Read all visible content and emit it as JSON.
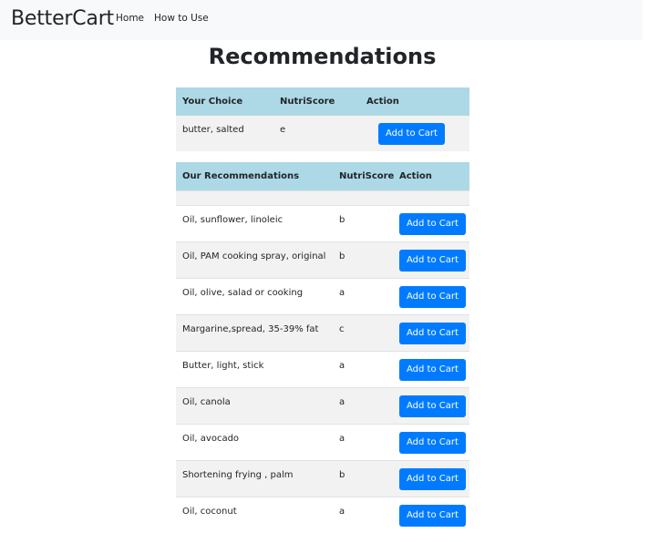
{
  "navbar": {
    "brand": "BetterCart",
    "links": [
      "Home",
      "How to Use"
    ]
  },
  "page_title": "Recommendations",
  "choice_table": {
    "headers": [
      "Your Choice",
      "NutriScore",
      "Action"
    ],
    "row": {
      "name": "butter, salted",
      "score": "e",
      "action": "Add to Cart"
    }
  },
  "recommendations_table": {
    "headers": [
      "Our Recommendations",
      "NutriScore",
      "Action"
    ],
    "rows": [
      {
        "name": "Oil, sunflower, linoleic",
        "score": "b",
        "action": "Add to Cart"
      },
      {
        "name": "Oil, PAM cooking spray, original",
        "score": "b",
        "action": "Add to Cart"
      },
      {
        "name": "Oil, olive, salad or cooking",
        "score": "a",
        "action": "Add to Cart"
      },
      {
        "name": "Margarine,spread, 35-39% fat",
        "score": "c",
        "action": "Add to Cart"
      },
      {
        "name": "Butter, light, stick",
        "score": "a",
        "action": "Add to Cart"
      },
      {
        "name": "Oil, canola",
        "score": "a",
        "action": "Add to Cart"
      },
      {
        "name": "Oil, avocado",
        "score": "a",
        "action": "Add to Cart"
      },
      {
        "name": "Shortening frying , palm",
        "score": "b",
        "action": "Add to Cart"
      },
      {
        "name": "Oil, coconut",
        "score": "a",
        "action": "Add to Cart"
      }
    ]
  },
  "colors": {
    "header_bg": "#add8e6",
    "button_bg": "#007bff",
    "navbar_bg": "#f8f9fa",
    "stripe_bg": "#f2f2f2"
  }
}
